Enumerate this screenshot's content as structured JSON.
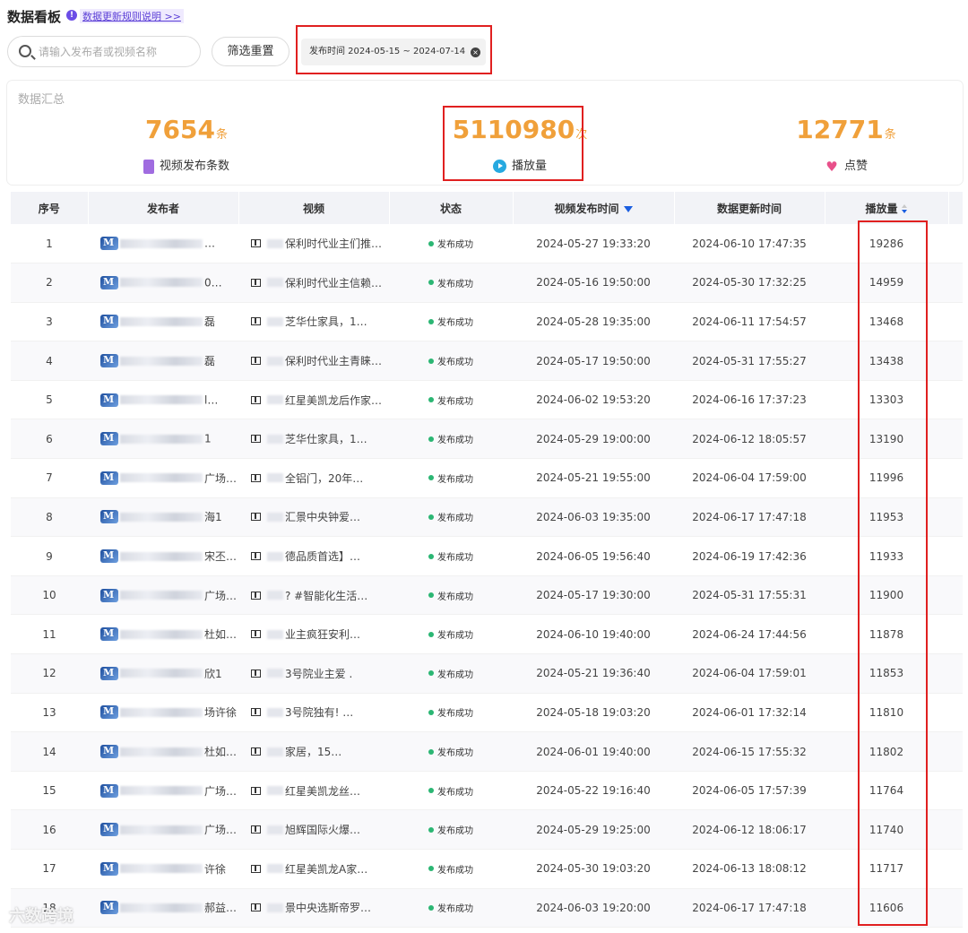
{
  "header": {
    "title": "数据看板",
    "rules_link": "数据更新规则说明 >>"
  },
  "filters": {
    "search_placeholder": "请输入发布者或视频名称",
    "reset_label": "筛选重置",
    "date_range": "发布时间 2024-05-15 ~ 2024-07-14"
  },
  "summary": {
    "label": "数据汇总",
    "stats": [
      {
        "value": "7654",
        "unit": "条",
        "caption": "视频发布条数",
        "icon": "video-icon"
      },
      {
        "value": "5110980",
        "unit": "次",
        "caption": "播放量",
        "icon": "play-icon"
      },
      {
        "value": "12771",
        "unit": "条",
        "caption": "点赞",
        "icon": "heart-icon"
      }
    ]
  },
  "colors": {
    "accent_orange": "#f0a03a",
    "highlight_red": "#e02020",
    "status_green": "#2bb673",
    "link_purple": "#5b3fd6"
  },
  "table": {
    "columns": [
      "序号",
      "发布者",
      "视频",
      "状态",
      "视频发布时间",
      "数据更新时间",
      "播放量"
    ],
    "rows": [
      {
        "no": "1",
        "publisher": "…",
        "video": "保利时代业主们推…",
        "status": "发布成功",
        "published": "2024-05-27 19:33:20",
        "updated": "2024-06-10 17:47:35",
        "plays": "19286"
      },
      {
        "no": "2",
        "publisher": "0…",
        "video": "保利时代业主信赖…",
        "status": "发布成功",
        "published": "2024-05-16 19:50:00",
        "updated": "2024-05-30 17:32:25",
        "plays": "14959"
      },
      {
        "no": "3",
        "publisher": "磊",
        "video": "芝华仕家具，1…",
        "status": "发布成功",
        "published": "2024-05-28 19:35:00",
        "updated": "2024-06-11 17:54:57",
        "plays": "13468"
      },
      {
        "no": "4",
        "publisher": "磊",
        "video": "保利时代业主青睐…",
        "status": "发布成功",
        "published": "2024-05-17 19:50:00",
        "updated": "2024-05-31 17:55:27",
        "plays": "13438"
      },
      {
        "no": "5",
        "publisher": "l…",
        "video": "红星美凯龙后作家…",
        "status": "发布成功",
        "published": "2024-06-02 19:53:20",
        "updated": "2024-06-16 17:37:23",
        "plays": "13303"
      },
      {
        "no": "6",
        "publisher": "1",
        "video": "芝华仕家具，1…",
        "status": "发布成功",
        "published": "2024-05-29 19:00:00",
        "updated": "2024-06-12 18:05:57",
        "plays": "13190"
      },
      {
        "no": "7",
        "publisher": "广场…",
        "video": "全铝门，20年…",
        "status": "发布成功",
        "published": "2024-05-21 19:55:00",
        "updated": "2024-06-04 17:59:00",
        "plays": "11996"
      },
      {
        "no": "8",
        "publisher": "海1",
        "video": "汇景中央钟爱…",
        "status": "发布成功",
        "published": "2024-06-03 19:35:00",
        "updated": "2024-06-17 17:47:18",
        "plays": "11953"
      },
      {
        "no": "9",
        "publisher": "宋丕…",
        "video": "德品质首选】…",
        "status": "发布成功",
        "published": "2024-06-05 19:56:40",
        "updated": "2024-06-19 17:42:36",
        "plays": "11933"
      },
      {
        "no": "10",
        "publisher": "广场…",
        "video": "? #智能化生活…",
        "status": "发布成功",
        "published": "2024-05-17 19:30:00",
        "updated": "2024-05-31 17:55:31",
        "plays": "11900"
      },
      {
        "no": "11",
        "publisher": "杜如…",
        "video": "业主疯狂安利…",
        "status": "发布成功",
        "published": "2024-06-10 19:40:00",
        "updated": "2024-06-24 17:44:56",
        "plays": "11878"
      },
      {
        "no": "12",
        "publisher": "欣1",
        "video": "3号院业主爱 .",
        "status": "发布成功",
        "published": "2024-05-21 19:36:40",
        "updated": "2024-06-04 17:59:01",
        "plays": "11853"
      },
      {
        "no": "13",
        "publisher": "场许徐",
        "video": "3号院独有! …",
        "status": "发布成功",
        "published": "2024-05-18 19:03:20",
        "updated": "2024-06-01 17:32:14",
        "plays": "11810"
      },
      {
        "no": "14",
        "publisher": "杜如…",
        "video": "家居，15…",
        "status": "发布成功",
        "published": "2024-06-01 19:40:00",
        "updated": "2024-06-15 17:55:32",
        "plays": "11802"
      },
      {
        "no": "15",
        "publisher": "广场…",
        "video": "红星美凯龙丝…",
        "status": "发布成功",
        "published": "2024-05-22 19:16:40",
        "updated": "2024-06-05 17:57:39",
        "plays": "11764"
      },
      {
        "no": "16",
        "publisher": "广场…",
        "video": "旭辉国际火爆…",
        "status": "发布成功",
        "published": "2024-05-29 19:25:00",
        "updated": "2024-06-12 18:06:17",
        "plays": "11740"
      },
      {
        "no": "17",
        "publisher": "许徐",
        "video": "红星美凯龙A家…",
        "status": "发布成功",
        "published": "2024-05-30 19:03:20",
        "updated": "2024-06-13 18:08:12",
        "plays": "11717"
      },
      {
        "no": "18",
        "publisher": "郝益…",
        "video": "景中央选斯帝罗…",
        "status": "发布成功",
        "published": "2024-06-03 19:20:00",
        "updated": "2024-06-17 17:47:18",
        "plays": "11606"
      }
    ]
  },
  "watermark": "六数跨境"
}
